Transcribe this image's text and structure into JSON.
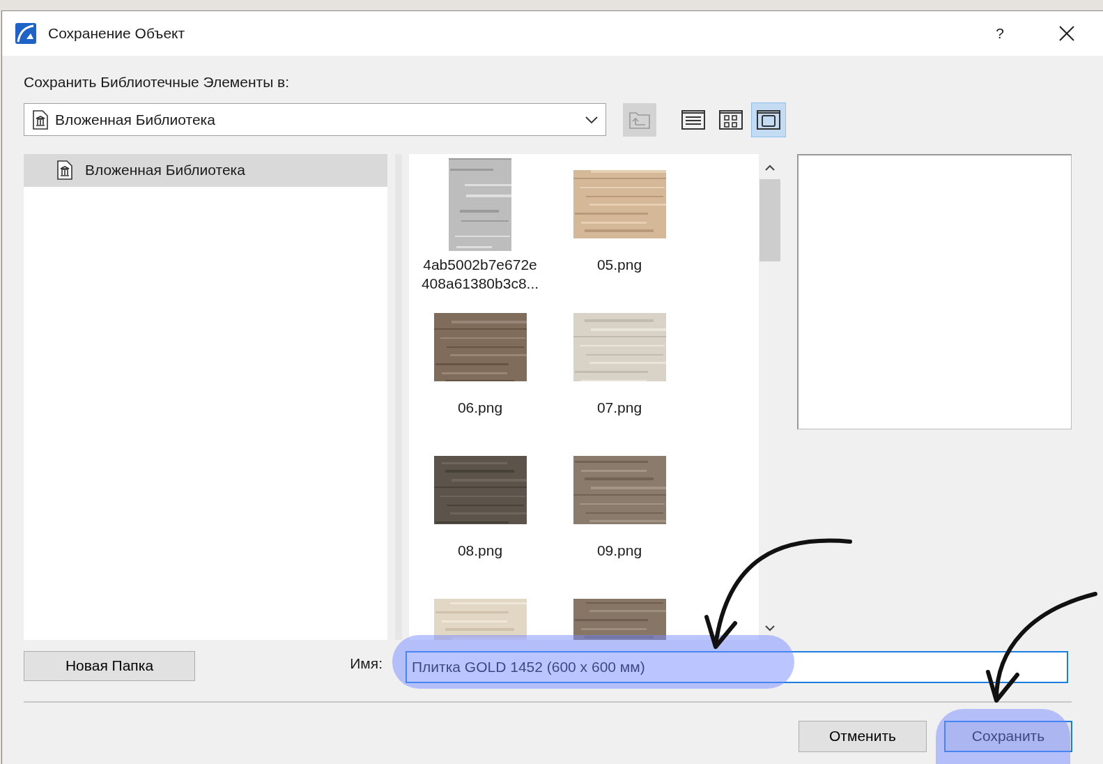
{
  "window": {
    "title": "Сохранение Объект",
    "help": "?"
  },
  "location": {
    "label": "Сохранить Библиотечные Элементы в:",
    "value": "Вложенная Библиотека"
  },
  "toolbar": {
    "up_folder": {
      "disabled": true
    },
    "view_modes": [
      {
        "kind": "list",
        "selected": false
      },
      {
        "kind": "grid",
        "selected": false
      },
      {
        "kind": "single",
        "selected": true
      }
    ]
  },
  "tree": {
    "items": [
      {
        "label": "Вложенная Библиотека",
        "selected": true
      }
    ]
  },
  "files": [
    {
      "name": "4ab5002b7e672e\n408a61380b3c8...",
      "kind": "picture"
    },
    {
      "name": "05.png",
      "kind": "picture"
    },
    {
      "name": "06.png",
      "kind": "picture"
    },
    {
      "name": "07.png",
      "kind": "picture"
    },
    {
      "name": "08.png",
      "kind": "picture"
    },
    {
      "name": "09.png",
      "kind": "picture"
    },
    {
      "kind": "picture"
    },
    {
      "kind": "picture"
    }
  ],
  "name_field": {
    "label": "Имя:",
    "value": "Плитка GOLD 1452 (600 x 600 мм)"
  },
  "new_folder_button": "Новая Папка",
  "buttons": [
    {
      "label": "Отменить",
      "default": false
    },
    {
      "label": "Сохранить",
      "default": true
    }
  ]
}
